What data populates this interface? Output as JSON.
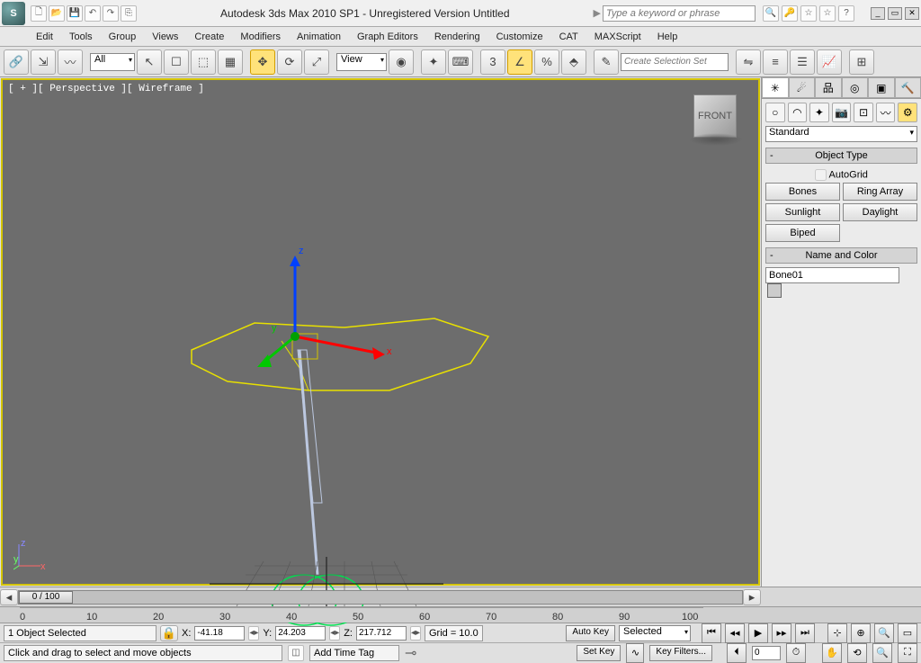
{
  "title": "Autodesk 3ds Max 2010 SP1 - Unregistered Version   Untitled",
  "search_placeholder": "Type a keyword or phrase",
  "menus": [
    "Edit",
    "Tools",
    "Group",
    "Views",
    "Create",
    "Modifiers",
    "Animation",
    "Graph Editors",
    "Rendering",
    "Customize",
    "CAT",
    "MAXScript",
    "Help"
  ],
  "toolbar": {
    "filter_dd": "All",
    "refsys_dd": "View",
    "named_sel": "Create Selection Set"
  },
  "viewport": {
    "label": "[ + ][ Perspective ][ Wireframe ]",
    "cube_face": "FRONT"
  },
  "sidepanel": {
    "dropdown": "Standard",
    "rollout_objtype": "Object Type",
    "autogrid": "AutoGrid",
    "buttons": [
      "Bones",
      "Ring Array",
      "Sunlight",
      "Daylight",
      "Biped",
      ""
    ],
    "rollout_namecolor": "Name and Color",
    "object_name": "Bone01"
  },
  "timeline": {
    "slider_label": "0 / 100",
    "ticks": [
      0,
      10,
      20,
      30,
      40,
      50,
      60,
      70,
      80,
      90,
      100
    ]
  },
  "status": {
    "selection": "1 Object Selected",
    "x_lbl": "X:",
    "x": "-41.18",
    "y_lbl": "Y:",
    "y": "24.203",
    "z_lbl": "Z:",
    "z": "217.712",
    "grid_lbl": "Grid = 10.0",
    "add_tag": "Add Time Tag",
    "prompt": "Click and drag to select and move objects",
    "autokey": "Auto Key",
    "setkey": "Set Key",
    "selected": "Selected",
    "keyfilters": "Key Filters..."
  },
  "axis": {
    "x": "x",
    "y": "y",
    "z": "z"
  }
}
